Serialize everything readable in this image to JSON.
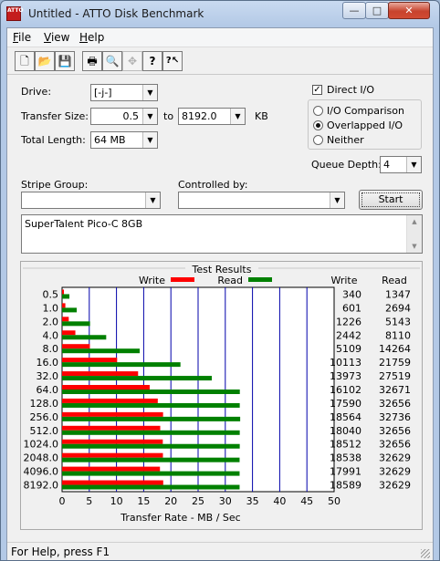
{
  "window": {
    "title": "Untitled - ATTO Disk Benchmark",
    "app_icon_text": "ATTO",
    "min": "—",
    "max": "□",
    "close": "✕"
  },
  "menu": [
    {
      "label": "File",
      "key": "F",
      "rest": "ile"
    },
    {
      "label": "View",
      "key": "V",
      "rest": "iew"
    },
    {
      "label": "Help",
      "key": "H",
      "rest": "elp"
    }
  ],
  "toolbar": {
    "new_icon": "🗋",
    "open_icon": "📂",
    "save_icon": "💾",
    "print_icon": "🖶",
    "preview_icon": "🔍",
    "move_icon": "✥",
    "help_icon": "?",
    "context_help_icon": "?↖"
  },
  "settings": {
    "drive_label": "Drive:",
    "drive_value": "[-j-]",
    "transfer_size_label": "Transfer Size:",
    "transfer_from": "0.5",
    "to_label": "to",
    "transfer_to": "8192.0",
    "kb_label": "KB",
    "total_length_label": "Total Length:",
    "total_length": "64 MB",
    "direct_io_label": "Direct I/O",
    "direct_io_checked": true,
    "io_options": [
      "I/O Comparison",
      "Overlapped I/O",
      "Neither"
    ],
    "io_selected": 1,
    "queue_depth_label": "Queue Depth:",
    "queue_depth": "4",
    "stripe_group_label": "Stripe Group:",
    "stripe_group": "",
    "controlled_by_label": "Controlled by:",
    "controlled_by": "",
    "start_label": "Start",
    "description": "SuperTalent Pico-C 8GB"
  },
  "results": {
    "title": "Test Results",
    "write_label": "Write",
    "read_label": "Read"
  },
  "chart_data": {
    "type": "bar",
    "orientation": "horizontal",
    "xlabel": "Transfer Rate - MB / Sec",
    "xlim": [
      0,
      50
    ],
    "xticks": [
      0,
      5,
      10,
      15,
      20,
      25,
      30,
      35,
      40,
      45,
      50
    ],
    "categories": [
      "0.5",
      "1.0",
      "2.0",
      "4.0",
      "8.0",
      "16.0",
      "32.0",
      "64.0",
      "128.0",
      "256.0",
      "512.0",
      "1024.0",
      "2048.0",
      "4096.0",
      "8192.0"
    ],
    "series": [
      {
        "name": "Write",
        "color": "#ff0000",
        "values": [
          0.34,
          0.601,
          1.226,
          2.442,
          5.109,
          10.113,
          13.973,
          16.102,
          17.59,
          18.564,
          18.04,
          18.512,
          18.538,
          17.991,
          18.589
        ]
      },
      {
        "name": "Read",
        "color": "#008000",
        "values": [
          1.347,
          2.694,
          5.143,
          8.11,
          14.264,
          21.759,
          27.519,
          32.671,
          32.656,
          32.736,
          32.656,
          32.656,
          32.629,
          32.629,
          32.629
        ]
      }
    ],
    "write_column": [
      "340",
      "601",
      "1226",
      "2442",
      "5109",
      "10113",
      "13973",
      "16102",
      "17590",
      "18564",
      "18040",
      "18512",
      "18538",
      "17991",
      "18589"
    ],
    "read_column": [
      "1347",
      "2694",
      "5143",
      "8110",
      "14264",
      "21759",
      "27519",
      "32671",
      "32656",
      "32736",
      "32656",
      "32656",
      "32629",
      "32629",
      "32629"
    ],
    "grid": true,
    "grid_color": "#0000aa",
    "legend": "top"
  },
  "status": {
    "text": "For Help, press F1"
  }
}
